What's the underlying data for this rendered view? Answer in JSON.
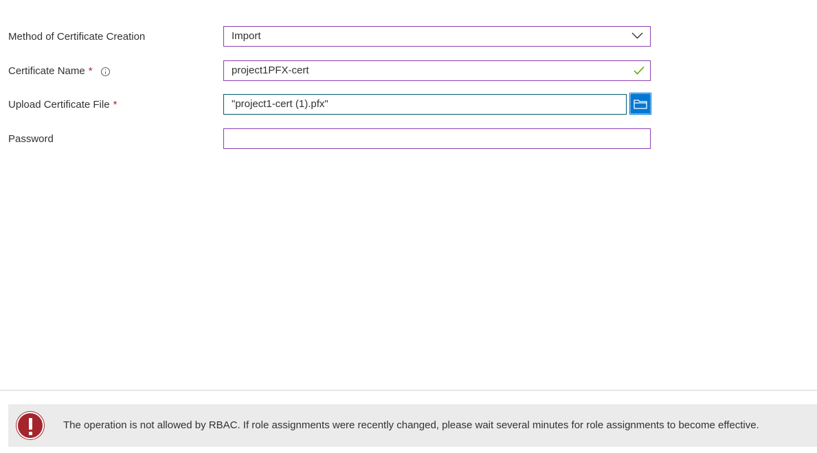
{
  "form": {
    "method": {
      "label": "Method of Certificate Creation",
      "value": "Import"
    },
    "cert_name": {
      "label": "Certificate Name",
      "required_mark": "*",
      "value": "project1PFX-cert"
    },
    "upload": {
      "label": "Upload Certificate File",
      "required_mark": "*",
      "value": "\"project1-cert (1).pfx\""
    },
    "password": {
      "label": "Password",
      "value": ""
    }
  },
  "error": {
    "message": "The operation is not allowed by RBAC. If role assignments were recently changed, please wait several minutes for role assignments to become effective."
  },
  "colors": {
    "field_border": "#8a3fb0",
    "file_field_border": "#005b70",
    "accent": "#0078d4",
    "required": "#a4262c",
    "valid_check": "#57a300",
    "error_icon": "#a4262c",
    "error_bar": "#ebebeb"
  },
  "icons": [
    "info-icon",
    "chevron-down-icon",
    "checkmark-icon",
    "folder-icon",
    "error-icon"
  ]
}
